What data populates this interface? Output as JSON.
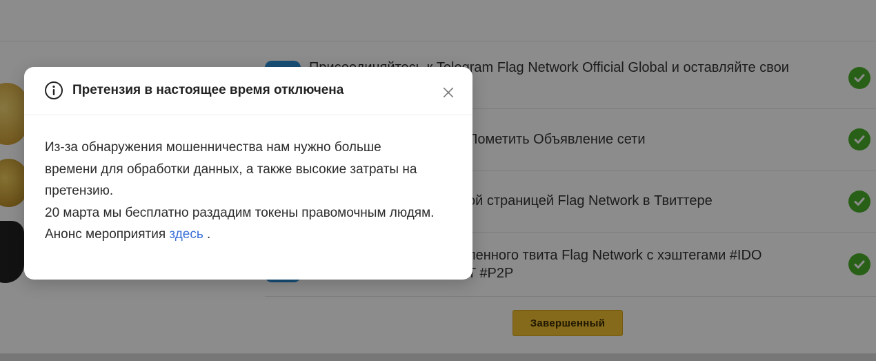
{
  "modal": {
    "title": "Претензия в настоящее время отключена",
    "body_line1": "Из-за обнаружения мошенничества нам нужно больше",
    "body_line2": "времени для обработки данных, а также высокие затраты на",
    "body_line3": "претензию.",
    "body_line4": "20 марта мы бесплатно раздадим токены правомочным людям.",
    "announce_prefix": "Анонс мероприятия",
    "announce_link": "здесь",
    "announce_suffix": " .",
    "close_glyph": "×"
  },
  "tasks": [
    {
      "line1": "Присоединяйтесь к Telegram Flag Network Official Global и оставляйте свои",
      "line2": ""
    },
    {
      "line1": "Пометить Объявление сети",
      "line2": ""
    },
    {
      "line1": "ой страницей Flag Network в Твиттере",
      "line2": ""
    },
    {
      "line1": "ленного твита Flag Network с хэштегами #IDO",
      "line2": "T #P2P"
    }
  ],
  "done_button": "Завершенный",
  "colors": {
    "accent": "#f2c233",
    "check": "#4caf2a",
    "link": "#3b6fd8"
  }
}
